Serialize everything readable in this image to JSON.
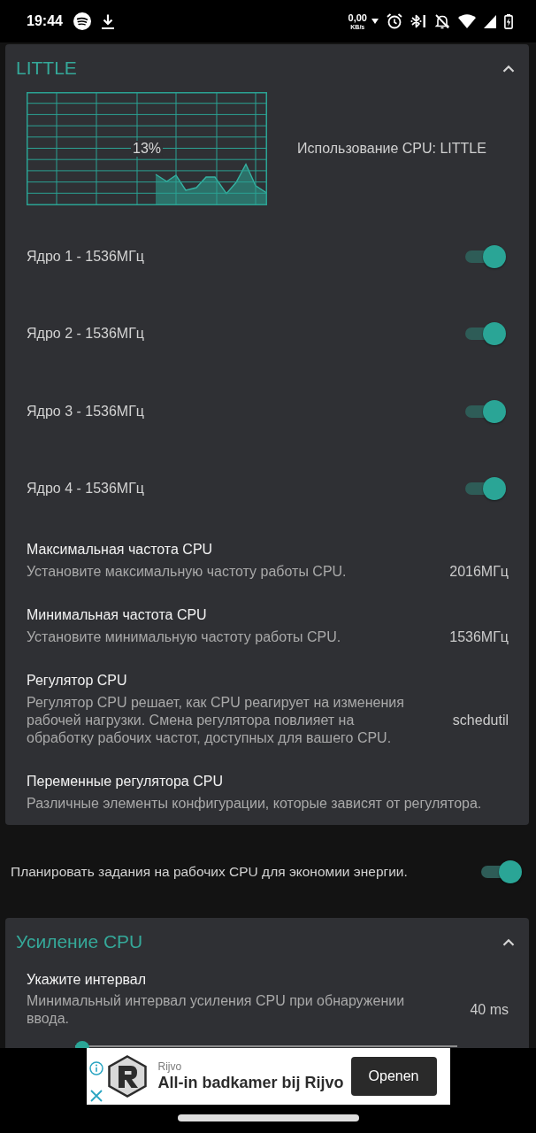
{
  "status_bar": {
    "time": "19:44",
    "net_speed": "0,00",
    "net_unit": "KB/s"
  },
  "blocks": [
    {
      "kind": "card",
      "title": "LITTLE",
      "expanded": true,
      "items": [
        {
          "kind": "graph",
          "reading": "13%",
          "label": "Использование CPU: LITTLE"
        },
        {
          "kind": "switch",
          "label": "Ядро 1 - 1536МГц",
          "on": true
        },
        {
          "kind": "switch",
          "label": "Ядро 2 - 1536МГц",
          "on": true
        },
        {
          "kind": "switch",
          "label": "Ядро 3 - 1536МГц",
          "on": true
        },
        {
          "kind": "switch",
          "label": "Ядро 4 - 1536МГц",
          "on": true
        },
        {
          "kind": "setting",
          "title": "Максимальная частота CPU",
          "description": "Установите максимальную частоту работы CPU.",
          "value": "2016МГц"
        },
        {
          "kind": "setting",
          "title": "Минимальная частота CPU",
          "description": "Установите минимальную частоту работы CPU.",
          "value": "1536МГц"
        },
        {
          "kind": "setting",
          "title": "Регулятор CPU",
          "description": "Регулятор CPU решает, как CPU реагирует на изменения рабочей нагрузки. Смена регулятора повлияет на обработку рабочих частот, доступных для вашего CPU.",
          "value": "schedutil"
        },
        {
          "kind": "setting",
          "title": "Переменные регулятора CPU",
          "description": "Различные элементы конфигурации, которые зависят от регулятора."
        }
      ]
    },
    {
      "kind": "switch_row",
      "label": "Планировать задания на рабочих CPU для экономии энергии.",
      "on": true
    },
    {
      "kind": "card",
      "title": "Усиление CPU",
      "expanded": true,
      "items": [
        {
          "kind": "slider_setting",
          "title": "Укажите интервал",
          "description": "Минимальный интервал усиления CPU при обнаружении ввода.",
          "value": "40 ms",
          "level": 0
        }
      ]
    }
  ],
  "ad": {
    "advertiser": "Rijvo",
    "headline": "All-in badkamer bij Rijvo",
    "button": "Openen"
  }
}
